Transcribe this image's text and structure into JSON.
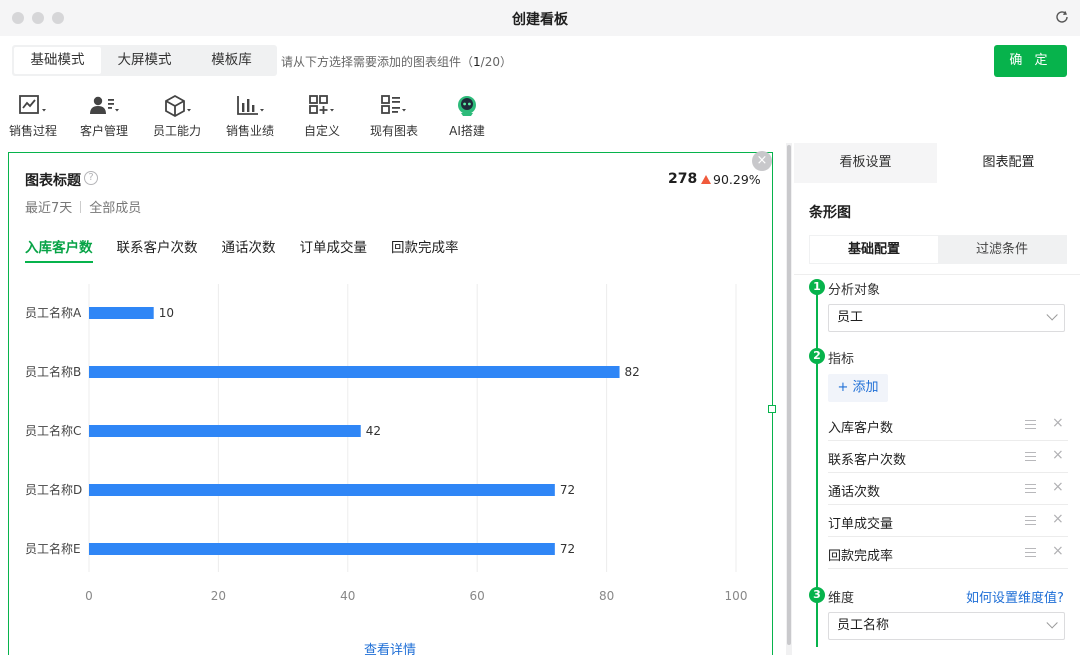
{
  "window": {
    "title": "创建看板"
  },
  "modes": [
    "基础模式",
    "大屏模式",
    "模板库"
  ],
  "hint": {
    "text": "请从下方选择需要添加的图表组件（",
    "current": "1",
    "total": "/20）"
  },
  "confirm_label": "确 定",
  "toolbar": [
    {
      "label": "销售过程",
      "icon": "line-chart-icon"
    },
    {
      "label": "客户管理",
      "icon": "customer-icon"
    },
    {
      "label": "员工能力",
      "icon": "cube-icon"
    },
    {
      "label": "销售业绩",
      "icon": "bar-chart-icon"
    },
    {
      "label": "自定义",
      "icon": "grid-add-icon"
    },
    {
      "label": "现有图表",
      "icon": "list-chart-icon"
    },
    {
      "label": "AI搭建",
      "icon": "ai-robot-icon"
    }
  ],
  "card": {
    "title": "图表标题",
    "total": "278",
    "change": "90.29%",
    "period": "最近7天",
    "scope": "全部成员",
    "metric_tabs": [
      "入库客户数",
      "联系客户次数",
      "通话次数",
      "订单成交量",
      "回款完成率"
    ],
    "detail_link": "查看详情",
    "close": "×"
  },
  "chart_data": {
    "type": "bar",
    "orientation": "horizontal",
    "categories": [
      "员工名称A",
      "员工名称B",
      "员工名称C",
      "员工名称D",
      "员工名称E"
    ],
    "values": [
      10,
      82,
      42,
      72,
      72
    ],
    "xlim": [
      0,
      100
    ],
    "xticks": [
      0,
      20,
      40,
      60,
      80,
      100
    ],
    "grid": true,
    "bar_color": "#2f86f6"
  },
  "panel": {
    "tabs": [
      "看板设置",
      "图表配置"
    ],
    "chart_type": "条形图",
    "subtabs": [
      "基础配置",
      "过滤条件"
    ],
    "steps": [
      "1",
      "2",
      "3"
    ],
    "analysis_label": "分析对象",
    "analysis_value": "员工",
    "metrics_label": "指标",
    "add_label": "+ 添加",
    "metrics": [
      "入库客户数",
      "联系客户次数",
      "通话次数",
      "订单成交量",
      "回款完成率"
    ],
    "dimension_label": "维度",
    "dimension_link": "如何设置维度值?",
    "dimension_value": "员工名称",
    "remove": "×"
  },
  "colors": {
    "accent": "#07b34c",
    "link": "#1f6fd6",
    "bar": "#2f86f6",
    "up": "#f05a3c"
  }
}
